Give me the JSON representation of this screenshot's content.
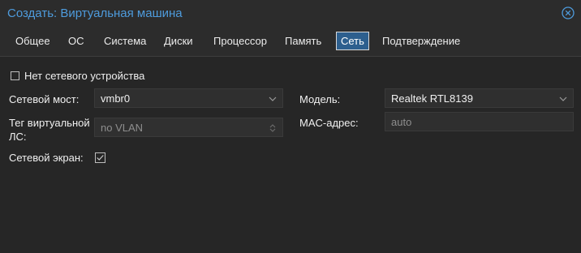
{
  "window": {
    "title": "Создать: Виртуальная машина"
  },
  "tabs": [
    {
      "label": "Общее"
    },
    {
      "label": "ОС"
    },
    {
      "label": "Система"
    },
    {
      "label": "Диски"
    },
    {
      "label": "Процессор"
    },
    {
      "label": "Память"
    },
    {
      "label": "Сеть",
      "active": true
    },
    {
      "label": "Подтверждение"
    }
  ],
  "form": {
    "no_network": {
      "label": "Нет сетевого устройства",
      "checked": false
    },
    "bridge": {
      "label": "Сетевой мост:",
      "value": "vmbr0"
    },
    "vlan_tag": {
      "label_line1": "Тег виртуальной",
      "label_line2": "ЛС:",
      "placeholder": "no VLAN"
    },
    "firewall": {
      "label": "Сетевой экран:",
      "checked": true
    },
    "model": {
      "label": "Модель:",
      "value": "Realtek RTL8139"
    },
    "mac": {
      "label": "MAC-адрес:",
      "placeholder": "auto"
    }
  },
  "colors": {
    "accent": "#4e9bdc",
    "active_tab_bg": "#2d5f8e",
    "background": "#262626"
  },
  "icons": {
    "close": "close-circle-icon",
    "dropdown": "chevron-down-icon",
    "spinner": "spinner-arrows-icon",
    "checkbox_checked": "check-icon"
  }
}
